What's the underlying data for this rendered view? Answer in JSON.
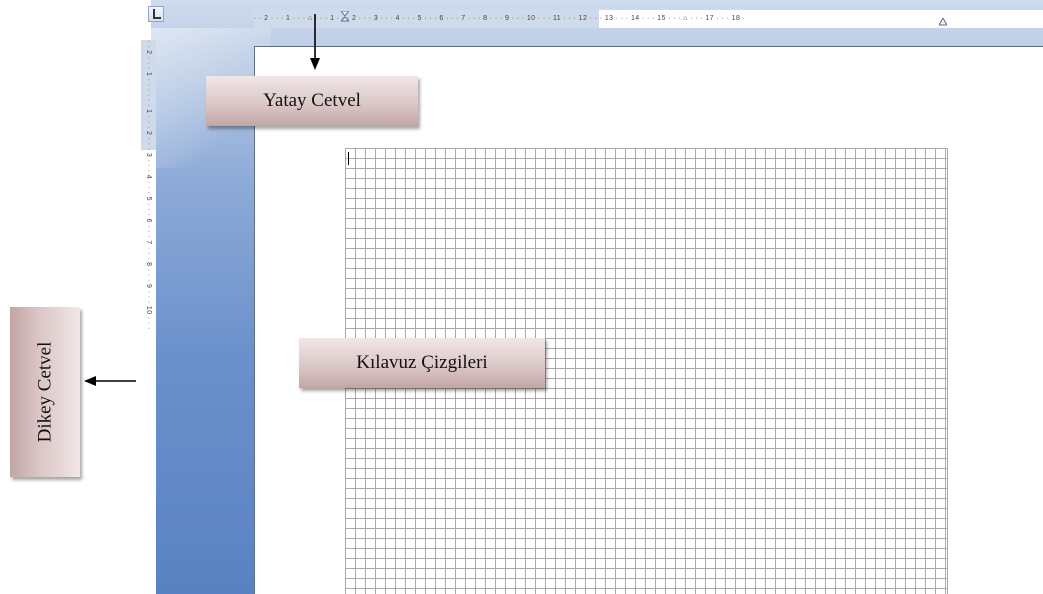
{
  "horizontal_ruler": {
    "ticks": "· · 2 · · · 1 · · · ⌂ · · · 1 · · · 2 · · · 3 · · · 4 · · · 5 · · · 6 · · · 7 · · · 8 · · · 9 · · · 10 · · · 11 · · · 12 · · · 13 · · · 14 · · · 15 · · · ⌂ · · · 17 · · · 18 ·"
  },
  "vertical_ruler": {
    "ticks": "· · 2 · · · 1 · · · · · · 1 · · · 2 · · · 3 · · · 4 · · · 5 · · · 6 · · · 7 · · · 8 · · · 9 · · · 10 · · · "
  },
  "labels": {
    "horizontal_ruler_label": "Yatay Cetvel",
    "vertical_ruler_label": "Dikey Cetvel",
    "gridlines_label": "Kılavuz Çizgileri"
  },
  "icons": {
    "tab_selector": "tab-stop-icon",
    "indent": "indent-marker-icon",
    "arrow": "arrow-icon"
  },
  "colors": {
    "ruler": "#cfdaeb",
    "workspace": "#6b90cb",
    "callout": "#dcc8c8",
    "grid": "#a9a9a9"
  }
}
